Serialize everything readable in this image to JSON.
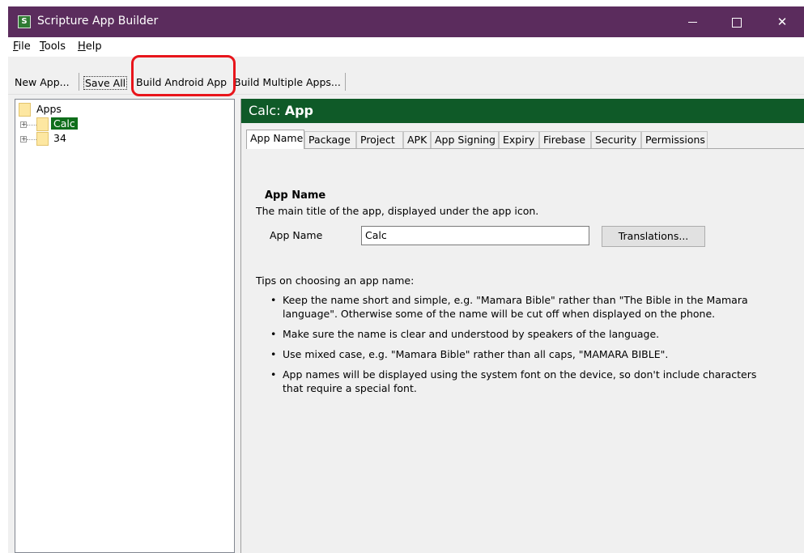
{
  "window": {
    "title": "Scripture App Builder",
    "icon": "scripture-app-icon",
    "controls": {
      "minimize": "minimize-icon",
      "maximize": "maximize-icon",
      "close": "✕"
    },
    "titlebar_color": "#5b2c5d"
  },
  "menu": [
    {
      "label": "File",
      "mnemonic": "F",
      "rest": "ile"
    },
    {
      "label": "Tools",
      "mnemonic": "T",
      "rest": "ools"
    },
    {
      "label": "Help",
      "mnemonic": "H",
      "rest": "elp"
    }
  ],
  "toolbar": {
    "new_app": "New App...",
    "save_all": "Save All",
    "build_android_app": "Build Android App",
    "build_multiple_apps": "Build Multiple Apps...",
    "highlight_color": "#e8151b"
  },
  "tree": {
    "root": "Apps",
    "items": [
      {
        "label": "Calc",
        "selected": true
      },
      {
        "label": "34",
        "selected": false
      }
    ],
    "selection_color": "#0f6e1b"
  },
  "panel": {
    "header_name": "Calc:",
    "header_type": "App",
    "header_color": "#0f5a28",
    "tabs": [
      "App Name",
      "Package",
      "Project",
      "APK",
      "App Signing",
      "Expiry",
      "Firebase",
      "Security",
      "Permissions"
    ],
    "active_tab": "App Name"
  },
  "app_name_section": {
    "title": "App Name",
    "description": "The main title of the app, displayed under the app icon.",
    "field_label": "App Name",
    "field_value": "Calc",
    "translations_button": "Translations...",
    "tips_title": "Tips on choosing an app name:",
    "tips": [
      "Keep the name short and simple, e.g. \"Mamara Bible\" rather than \"The Bible in the Mamara language\". Otherwise some of the name will be cut off when displayed on the phone.",
      "Make sure the name is clear and understood by speakers of the language.",
      "Use mixed case, e.g. \"Mamara Bible\" rather than all caps, \"MAMARA BIBLE\".",
      "App names will be displayed using the system font on the device, so don't include characters that require a special font."
    ]
  }
}
